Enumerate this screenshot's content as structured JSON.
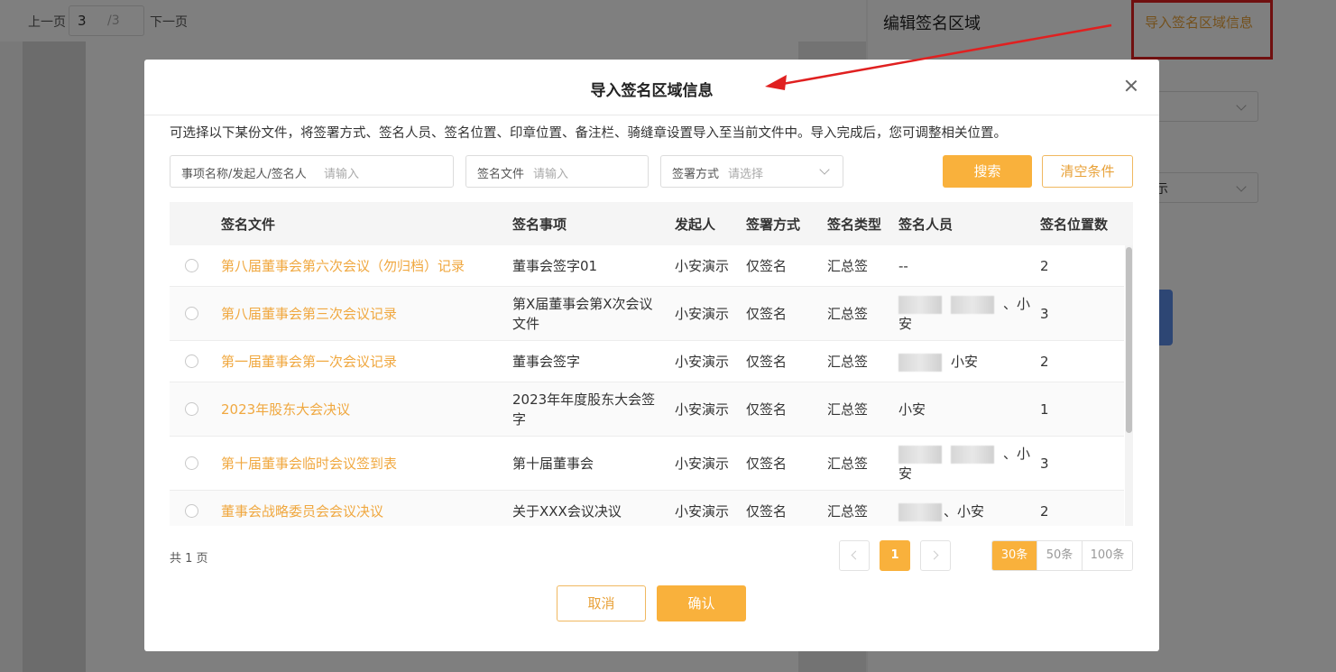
{
  "bg": {
    "prev_page": "上一页",
    "page_current": "3",
    "page_total": "/3",
    "next_page": "下一页",
    "right_title": "编辑签名区域",
    "right_link": "导入签名区域信息",
    "select2_text": "示"
  },
  "modal": {
    "title": "导入签名区域信息",
    "description": "可选择以下某份文件，将签署方式、签名人员、签名位置、印章位置、备注栏、骑缝章设置导入至当前文件中。导入完成后，您可调整相关位置。",
    "filters": {
      "project_label": "事项名称/发起人/签名人",
      "project_placeholder": "请输入",
      "file_label": "签名文件",
      "file_placeholder": "请输入",
      "method_label": "签署方式",
      "method_placeholder": "请选择"
    },
    "search_button": "搜索",
    "clear_button": "清空条件",
    "table": {
      "headers": [
        "签名文件",
        "签名事项",
        "发起人",
        "签署方式",
        "签名类型",
        "签名人员",
        "签名位置数"
      ],
      "rows": [
        {
          "file": "第八届董事会第六次会议（勿归档）记录",
          "item": "董事会签字01",
          "initiator": "小安演示",
          "method": "仅签名",
          "type": "汇总签",
          "signers": "--",
          "positions": "2"
        },
        {
          "file": "第八届董事会第三次会议记录",
          "item": "第X届董事会第X次会议文件",
          "initiator": "小安演示",
          "method": "仅签名",
          "type": "汇总签",
          "signers": "、小安",
          "positions": "3"
        },
        {
          "file": "第一届董事会第一次会议记录",
          "item": "董事会签字",
          "initiator": "小安演示",
          "method": "仅签名",
          "type": "汇总签",
          "signers": "小安",
          "positions": "2"
        },
        {
          "file": "2023年股东大会决议",
          "item": "2023年年度股东大会签字",
          "initiator": "小安演示",
          "method": "仅签名",
          "type": "汇总签",
          "signers": "小安",
          "positions": "1"
        },
        {
          "file": "第十届董事会临时会议签到表",
          "item": "第十届董事会",
          "initiator": "小安演示",
          "method": "仅签名",
          "type": "汇总签",
          "signers": "、小安",
          "positions": "3"
        },
        {
          "file": "董事会战略委员会会议决议",
          "item": "关于XXX会议决议",
          "initiator": "小安演示",
          "method": "仅签名",
          "type": "汇总签",
          "signers": "、小安",
          "positions": "2"
        }
      ]
    },
    "pagination": {
      "total_text": "共 1 页",
      "current_page": "1",
      "page_sizes": [
        "30条",
        "50条",
        "100条"
      ],
      "active_size": "30条"
    },
    "cancel_button": "取消",
    "confirm_button": "确认"
  },
  "colors": {
    "accent": "#f9b13c",
    "link": "#f0a840",
    "annotation_red": "#e02020"
  }
}
